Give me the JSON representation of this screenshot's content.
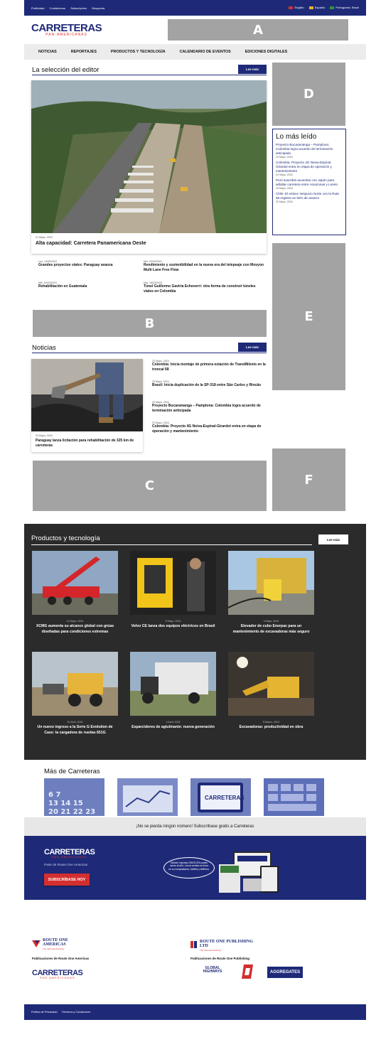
{
  "topbar": {
    "links": [
      "Publicidad",
      "Contáctenos",
      "Subscripción",
      "Búsqueda"
    ],
    "langs": [
      "English",
      "Español",
      "Portuguese, Brazil"
    ]
  },
  "brand": {
    "name": "CARRETERAS",
    "tagline": "PAN-AMERICANAS"
  },
  "ads": {
    "a": "A",
    "b": "B",
    "c": "C",
    "d": "D",
    "e": "E",
    "f": "F"
  },
  "nav": [
    "NOTICIAS",
    "REPORTAJES",
    "PRODUCTOS Y TECNOLOGÍA",
    "CALENDARIO DE EVENTOS",
    "EDICIONES DIGITALES"
  ],
  "editor": {
    "title": "La selección del editor",
    "more": "Lee más",
    "feature": {
      "date": "21 Mayo, 2024",
      "headline": "Alta capacidad: Carretera Panamericana Oeste"
    },
    "items": [
      {
        "date": "Lun, 13/05/2024",
        "headline": "Grandes proyectos viales: Paraguay avanza"
      },
      {
        "date": "Mié, 23/04/2024",
        "headline": "Rendimiento y sostenibilidad en la nueva era del telepeaje con Movyon Multi Lane Free Flow"
      },
      {
        "date": "Mié, 20/03/2024",
        "headline": "Rehabilitación en Guatemala"
      },
      {
        "date": "Mar, 16/03/2024",
        "headline": "Túnel Guillermo Gaviria Echeverri: otra forma de construir túneles viales en Colombia"
      }
    ]
  },
  "lomas": {
    "title": "Lo más leído",
    "items": [
      {
        "headline": "Proyecto Bucaramanga – Pamplona: Colombia logra acuerdo de terminación anticipada",
        "date": "23 Mayo, 2024"
      },
      {
        "headline": "Colombia: Proyecto 4G Neiva-Espinal-Girardot entra en etapa de operación y mantenimiento",
        "date": "22 Mayo, 2024"
      },
      {
        "headline": "Perú suscribió acuerdos con Japón para asfaltar carretera entre Amazonas y Loreto",
        "date": "15 Mayo, 2024"
      },
      {
        "headline": "Chile: El enlace Vespucio Norte con la Ruta 68 registra un 50% de avance",
        "date": "20 Mayo, 2024"
      }
    ]
  },
  "noticias": {
    "title": "Noticias",
    "more": "Lee más",
    "feature": {
      "date": "23 Mayo, 2024",
      "headline": "Paraguay lanza licitación para rehabilitación de 325 km de carreteras"
    },
    "items": [
      {
        "date": "23 Mayo, 2024",
        "headline": "Colombia: Inicia montaje de primera estación de TransMilenio en la troncal 68"
      },
      {
        "date": "23 Mayo, 2024",
        "headline": "Brasil: Inicia duplicación de la SP-318 entre São Carlos y Rincão"
      },
      {
        "date": "23 Mayo, 2024",
        "headline": "Proyecto Bucaramanga – Pamplona: Colombia logra acuerdo de terminación anticipada"
      },
      {
        "date": "22 Mayo, 2024",
        "headline": "Colombia: Proyecto 4G Neiva-Espinal-Girardot entra en etapa de operación y mantenimiento"
      }
    ]
  },
  "productos": {
    "title": "Productos y tecnología",
    "more": "Lee más",
    "items": [
      {
        "date": "14 Mayo, 2024",
        "headline": "XCMG aumenta su alcance global con grúas diseñadas para condiciones extremas"
      },
      {
        "date": "8 Mayo, 2024",
        "headline": "Volvo CE lanza dos equipos eléctricos en Brasil"
      },
      {
        "date": "3 Mayo, 2024",
        "headline": "Elevador de cubo Enerpac para un mantenimiento de excavadoras más seguro"
      },
      {
        "date": "30 Abril, 2024",
        "headline": "Un nuevo ingreso a la Serie G Evolution de Case: la cargadora de ruedas 651G"
      },
      {
        "date": "3 Abril, 2024",
        "headline": "Esparcidores de agiutinante: nueva generación"
      },
      {
        "date": "5 Marzo, 2024",
        "headline": "Excavadoras: productividad en obra"
      }
    ]
  },
  "mas": {
    "title": "Más de Carreteras",
    "items": [
      "Latest events",
      "Advertising / Media Information",
      "Digital Edition",
      "Contact Us"
    ]
  },
  "subscribe": {
    "bar": "¡No se pierda ningún número! Subscríbase gratis a Carreteras",
    "part_of": "Parte de Route One Americas",
    "button": "SUBSCRÍBASE HOY",
    "bubble": "Edición impresa GRATUITA cuatro veces al año. Lea la revista en línea en su computadora, tableta y teléfono."
  },
  "pubs": {
    "roa_name": "ROUTE ONE AMERICAS",
    "roa_sub": "The Informed Authority",
    "roa_label": "Publicaciones de Route One Americas",
    "rop_name": "ROUTE ONE PUBLISHING LTD",
    "rop_sub": "The Informed Authority",
    "rop_label": "Publicaciones de Route One Publishing",
    "gh": "GLOBAL HIGHWAYS",
    "aggregates": "AGGREGATES"
  },
  "footer": [
    "Política de Privacidad",
    "Términos y Condiciones"
  ],
  "colors": {
    "brand": "#1e2a78",
    "red": "#d32f2f",
    "dark": "#2b2b2b"
  }
}
